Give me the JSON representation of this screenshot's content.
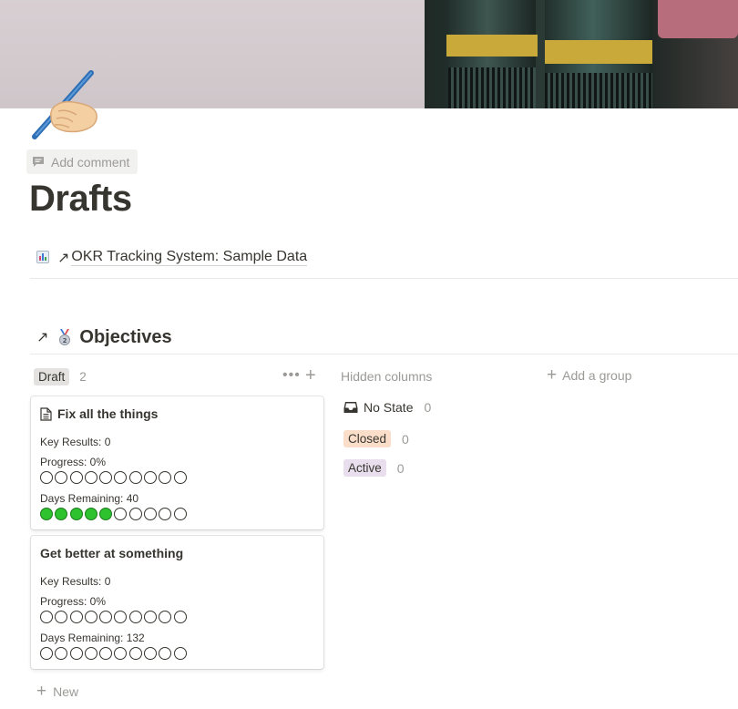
{
  "page": {
    "title": "Drafts",
    "add_comment_label": "Add comment",
    "linked_page": "OKR Tracking System: Sample Data"
  },
  "database": {
    "title": "Objectives",
    "group": {
      "label": "Draft",
      "count": "2",
      "more_label": "•••",
      "add_label": "+"
    },
    "cards": [
      {
        "title": "Fix all the things",
        "has_page_icon": true,
        "key_results_label": "Key Results: 0",
        "progress_label": "Progress: 0%",
        "progress_filled": 0,
        "days_label": "Days Remaining: 40",
        "days_filled": 5,
        "dots_total": 10
      },
      {
        "title": "Get better at something",
        "has_page_icon": false,
        "key_results_label": "Key Results: 0",
        "progress_label": "Progress: 0%",
        "progress_filled": 0,
        "days_label": "Days Remaining: 132",
        "days_filled": 0,
        "dots_total": 10
      }
    ],
    "new_label": "New",
    "hidden_columns_label": "Hidden columns",
    "add_group_label": "Add a group",
    "hidden_groups": [
      {
        "label": "No State",
        "count": "0"
      },
      {
        "label": "Closed",
        "count": "0"
      },
      {
        "label": "Active",
        "count": "0"
      }
    ]
  },
  "colors": {
    "dot_filled": "#2ec22e",
    "tag_draft": "#e3e2e0",
    "tag_closed": "#fadec9",
    "tag_active": "#e8deee"
  },
  "icons": {
    "page_icon": "writing-hand-icon",
    "comment": "comment-icon",
    "linked": "bar-chart-icon",
    "link_arrow": "arrow-up-right-icon",
    "database": "second-place-medal-icon",
    "card_page": "document-icon",
    "no_state": "inbox-icon"
  }
}
